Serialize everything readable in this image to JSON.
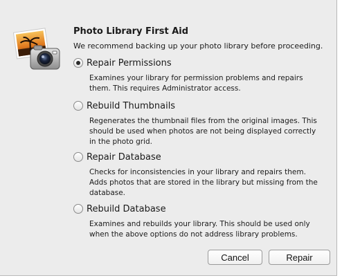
{
  "dialog": {
    "title": "Photo Library First Aid",
    "subtitle": "We recommend backing up your photo library before proceeding.",
    "icon": "iphoto-camera-icon"
  },
  "options": [
    {
      "label": "Repair Permissions",
      "selected": true,
      "description": [
        "Examines your library for permission problems and repairs",
        "them. This requires Administrator access."
      ]
    },
    {
      "label": "Rebuild Thumbnails",
      "selected": false,
      "description": [
        "Regenerates the thumbnail files from the original images. This",
        "should be used when photos are not being displayed correctly",
        "in the photo grid."
      ]
    },
    {
      "label": "Repair Database",
      "selected": false,
      "description": [
        "Checks for inconsistencies in your library and repairs them.",
        "Adds photos that are stored in the library but missing from the",
        "database."
      ]
    },
    {
      "label": "Rebuild Database",
      "selected": false,
      "description": [
        "Examines and rebuilds your library. This should be used only",
        "when the above options do not address library problems."
      ]
    }
  ],
  "buttons": {
    "cancel": "Cancel",
    "repair": "Repair"
  }
}
